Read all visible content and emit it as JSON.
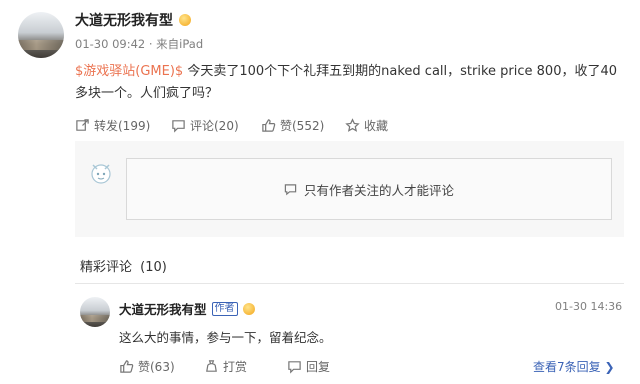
{
  "post": {
    "author": "大道无形我有型",
    "time": "01-30 09:42",
    "source": "· 来自iPad",
    "tag": "$游戏驿站(GME)$",
    "text": " 今天卖了100个下个礼拜五到期的naked call，strike price 800，收了40多块一个。人们疯了吗？",
    "actions": {
      "repost": "转发(199)",
      "comment": "评论(20)",
      "like": "赞(552)",
      "favorite": "收藏"
    }
  },
  "comment_box": {
    "restriction": "只有作者关注的人才能评论"
  },
  "featured": {
    "title": "精彩评论",
    "count": "(10)"
  },
  "comment": {
    "author": "大道无形我有型",
    "author_badge": "作者",
    "time": "01-30 14:36",
    "text": "这么大的事情，参与一下，留着纪念。",
    "like": "赞(63)",
    "tip": "打赏",
    "reply": "回复",
    "more_replies": "查看7条回复 ❯"
  },
  "colors": {
    "tag": "#eb7350",
    "link": "#3b63b6"
  }
}
